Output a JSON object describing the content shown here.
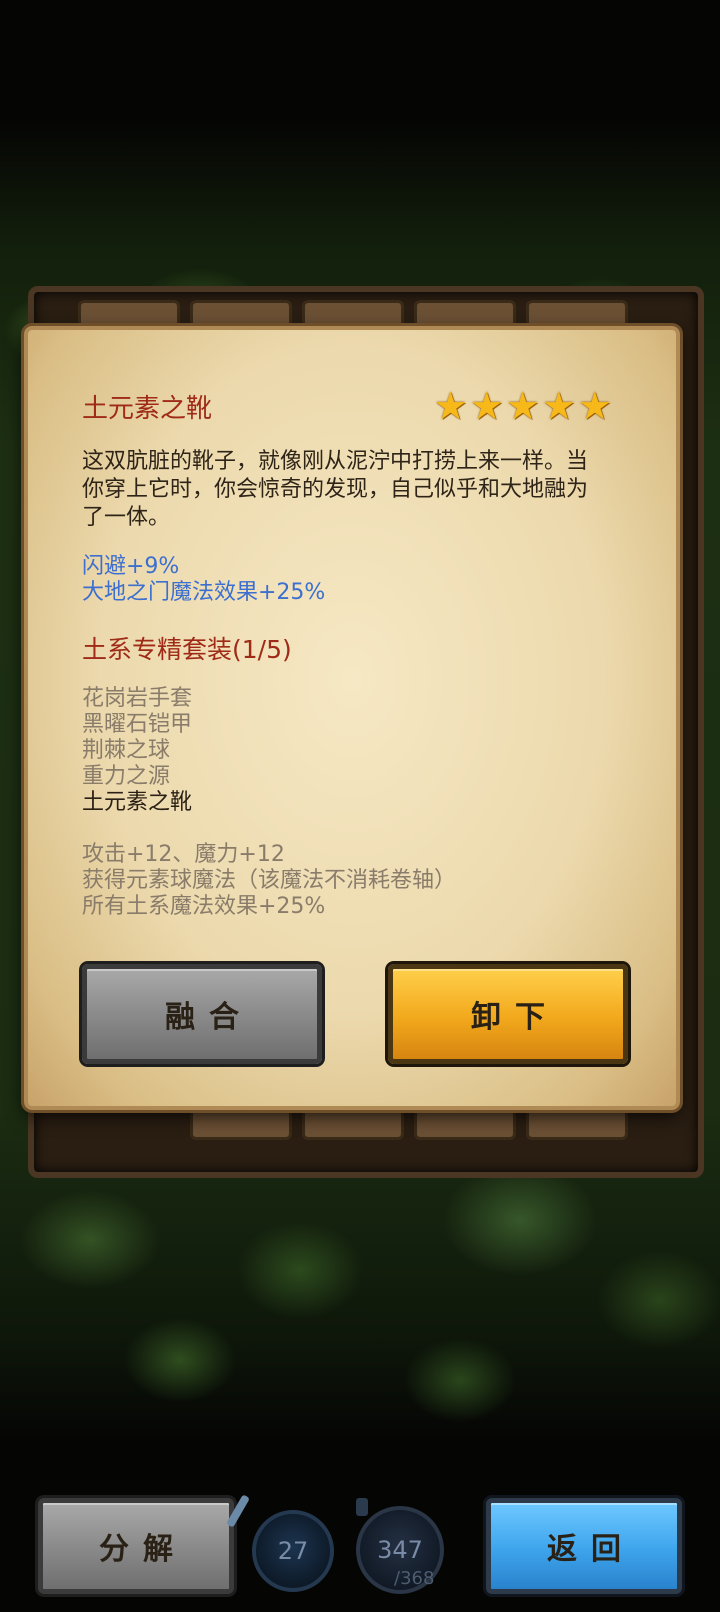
{
  "item": {
    "name": "土元素之靴",
    "stars": 5,
    "star_icon": "star-icon",
    "description": "这双肮脏的靴子，就像刚从泥泞中打捞上来一样。当你穿上它时，你会惊奇的发现，自己似乎和大地融为了一体。",
    "bonuses": [
      "闪避+9%",
      "大地之门魔法效果+25%"
    ]
  },
  "set": {
    "title": "土系专精套装(1/5)",
    "items": [
      {
        "label": "花岗岩手套",
        "owned": false
      },
      {
        "label": "黑曜石铠甲",
        "owned": false
      },
      {
        "label": "荆棘之球",
        "owned": false
      },
      {
        "label": "重力之源",
        "owned": false
      },
      {
        "label": "土元素之靴",
        "owned": true
      }
    ],
    "bonuses": [
      "攻击+12、魔力+12",
      "获得元素球魔法（该魔法不消耗卷轴）",
      "所有土系魔法效果+25%"
    ]
  },
  "buttons": {
    "fuse": "融合",
    "unequip": "卸下",
    "decompose": "分解",
    "back": "返回"
  },
  "hud": {
    "counter_a": "27",
    "mana_current": "347",
    "mana_max": "/368"
  },
  "colors": {
    "title_red": "#9e2a17",
    "bonus_blue": "#3c6fd0",
    "star_gold": "#f7b81a",
    "button_gold": "#f2a81c",
    "button_blue": "#3da4ec"
  }
}
